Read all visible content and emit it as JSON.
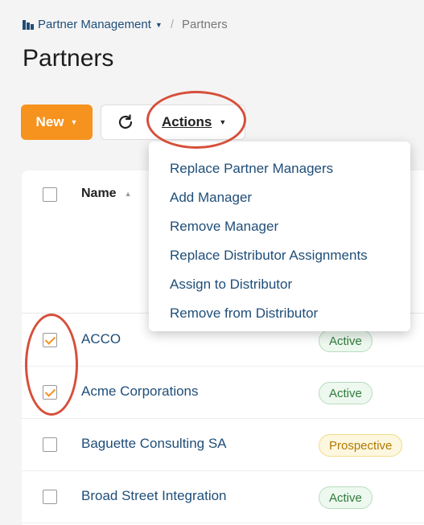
{
  "breadcrumb": {
    "parent": "Partner Management",
    "current": "Partners"
  },
  "page": {
    "title": "Partners"
  },
  "toolbar": {
    "new_label": "New",
    "actions_label": "Actions"
  },
  "table": {
    "name_header": "Name",
    "rows": [
      {
        "name": "ACCO",
        "status": "Active",
        "checked": true
      },
      {
        "name": "Acme Corporations",
        "status": "Active",
        "checked": true
      },
      {
        "name": "Baguette Consulting SA",
        "status": "Prospective",
        "checked": false
      },
      {
        "name": "Broad Street Integration",
        "status": "Active",
        "checked": false
      }
    ]
  },
  "actions_menu": [
    "Replace Partner Managers",
    "Add Manager",
    "Remove Manager",
    "Replace Distributor Assignments",
    "Assign to Distributor",
    "Remove from Distributor"
  ],
  "colors": {
    "accent": "#f6921e",
    "link": "#1f4e79",
    "annotation": "#d64f3a"
  }
}
